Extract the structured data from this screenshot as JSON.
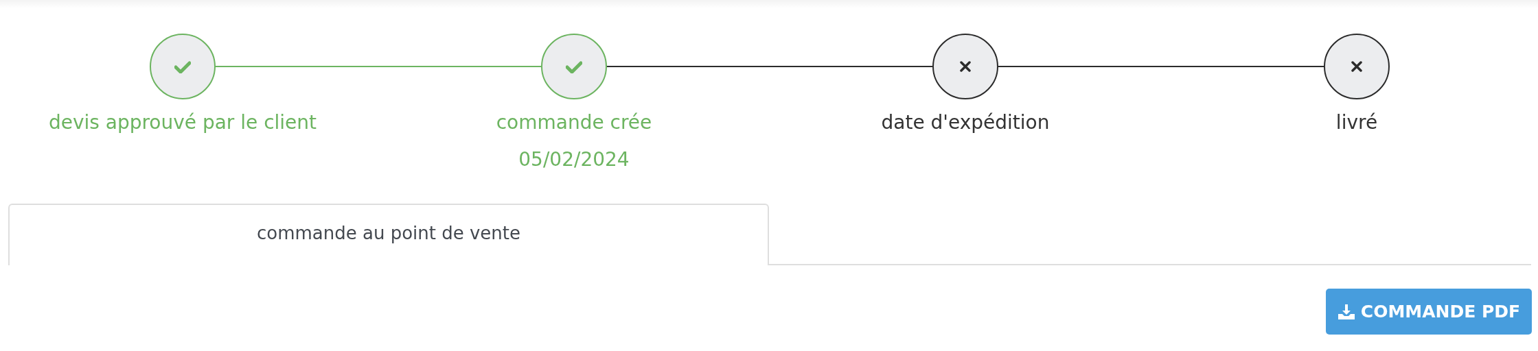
{
  "steps": [
    {
      "label": "devis approuvé par le client",
      "done": true
    },
    {
      "label": "commande crée",
      "date": "05/02/2024",
      "done": true
    },
    {
      "label": "date d'expédition",
      "done": false
    },
    {
      "label": "livré",
      "done": false
    }
  ],
  "tabs": [
    {
      "label": "commande au point de vente",
      "selected": true
    }
  ],
  "pdf_button": {
    "label": "COMMANDE PDF"
  }
}
